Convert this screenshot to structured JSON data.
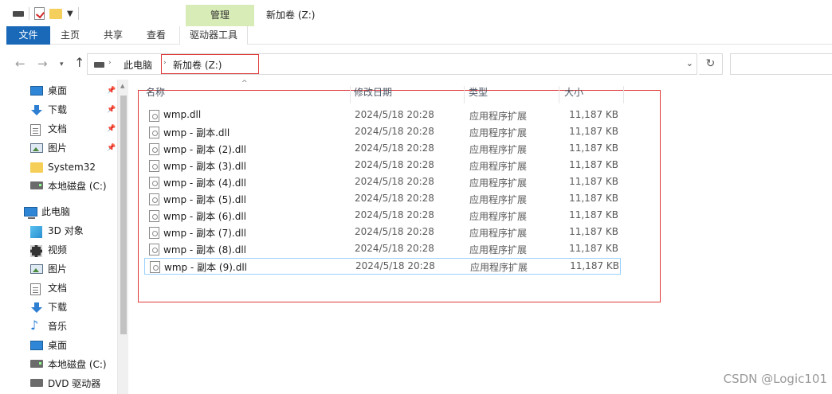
{
  "window": {
    "title": "新加卷 (Z:)",
    "context_tab_header": "管理"
  },
  "ribbon": {
    "tabs": {
      "file": "文件",
      "home": "主页",
      "share": "共享",
      "view": "查看",
      "drive_tools": "驱动器工具"
    }
  },
  "address": {
    "crumbs": [
      "此电脑",
      "新加卷 (Z:)"
    ]
  },
  "nav": {
    "items": [
      {
        "label": "桌面",
        "icon": "desktop-icon",
        "pinned": true
      },
      {
        "label": "下载",
        "icon": "download-icon",
        "pinned": true
      },
      {
        "label": "文档",
        "icon": "document-icon",
        "pinned": true
      },
      {
        "label": "图片",
        "icon": "picture-icon",
        "pinned": true
      },
      {
        "label": "System32",
        "icon": "folder-icon",
        "pinned": false
      },
      {
        "label": "本地磁盘 (C:)",
        "icon": "drive-icon",
        "pinned": false
      },
      {
        "label": "此电脑",
        "icon": "pc-icon",
        "pinned": false
      },
      {
        "label": "3D 对象",
        "icon": "3d-objects-icon",
        "pinned": false
      },
      {
        "label": "视频",
        "icon": "video-icon",
        "pinned": false
      },
      {
        "label": "图片",
        "icon": "picture-icon",
        "pinned": false
      },
      {
        "label": "文档",
        "icon": "document-icon",
        "pinned": false
      },
      {
        "label": "下载",
        "icon": "download-icon",
        "pinned": false
      },
      {
        "label": "音乐",
        "icon": "music-icon",
        "pinned": false
      },
      {
        "label": "桌面",
        "icon": "desktop-icon",
        "pinned": false
      },
      {
        "label": "本地磁盘 (C:)",
        "icon": "drive-icon",
        "pinned": false
      },
      {
        "label": "DVD 驱动器 (D:",
        "icon": "dvd-drive-icon",
        "pinned": false
      }
    ]
  },
  "columns": {
    "name": "名称",
    "date": "修改日期",
    "type": "类型",
    "size": "大小"
  },
  "files": [
    {
      "name": "wmp.dll",
      "date": "2024/5/18 20:28",
      "type": "应用程序扩展",
      "size": "11,187 KB"
    },
    {
      "name": "wmp - 副本.dll",
      "date": "2024/5/18 20:28",
      "type": "应用程序扩展",
      "size": "11,187 KB"
    },
    {
      "name": "wmp - 副本 (2).dll",
      "date": "2024/5/18 20:28",
      "type": "应用程序扩展",
      "size": "11,187 KB"
    },
    {
      "name": "wmp - 副本 (3).dll",
      "date": "2024/5/18 20:28",
      "type": "应用程序扩展",
      "size": "11,187 KB"
    },
    {
      "name": "wmp - 副本 (4).dll",
      "date": "2024/5/18 20:28",
      "type": "应用程序扩展",
      "size": "11,187 KB"
    },
    {
      "name": "wmp - 副本 (5).dll",
      "date": "2024/5/18 20:28",
      "type": "应用程序扩展",
      "size": "11,187 KB"
    },
    {
      "name": "wmp - 副本 (6).dll",
      "date": "2024/5/18 20:28",
      "type": "应用程序扩展",
      "size": "11,187 KB"
    },
    {
      "name": "wmp - 副本 (7).dll",
      "date": "2024/5/18 20:28",
      "type": "应用程序扩展",
      "size": "11,187 KB"
    },
    {
      "name": "wmp - 副本 (8).dll",
      "date": "2024/5/18 20:28",
      "type": "应用程序扩展",
      "size": "11,187 KB"
    },
    {
      "name": "wmp - 副本 (9).dll",
      "date": "2024/5/18 20:28",
      "type": "应用程序扩展",
      "size": "11,187 KB"
    }
  ],
  "watermark": "CSDN @Logic101",
  "colors": {
    "file_tab": "#1a69b8",
    "context_tab": "#d8ecb7",
    "highlight_box": "#e03a3a",
    "row_focus": "#99d1ff"
  }
}
